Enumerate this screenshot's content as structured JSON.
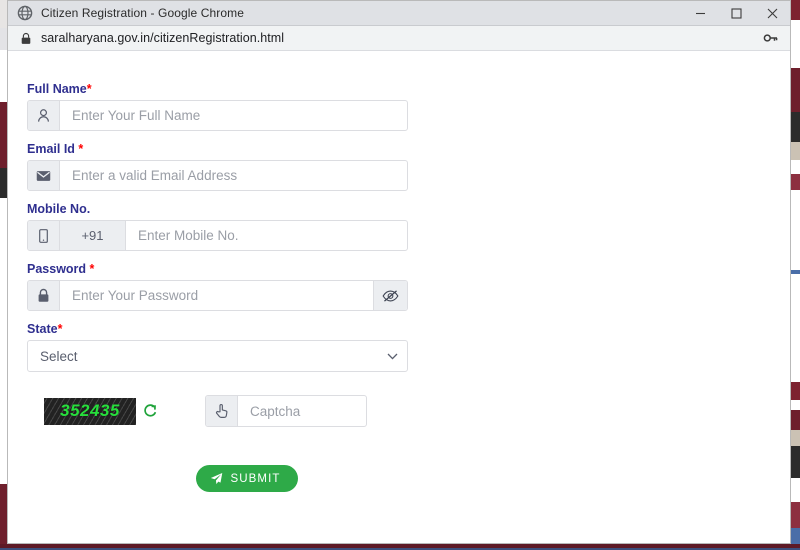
{
  "window": {
    "title": "Citizen Registration - Google Chrome",
    "app_icon": "chrome-globe-icon",
    "controls": {
      "minimize": "minimize-icon",
      "maximize": "maximize-icon",
      "close": "close-icon"
    }
  },
  "addressbar": {
    "security_icon": "lock-icon",
    "url": "saralharyana.gov.in/citizenRegistration.html",
    "password_manager_icon": "key-icon"
  },
  "form": {
    "fields": [
      {
        "label": "Full Name",
        "required": true,
        "required_mark": "*",
        "icon": "user-icon",
        "placeholder": "Enter Your Full Name",
        "value": ""
      },
      {
        "label": "Email Id",
        "required": true,
        "required_mark": "*",
        "icon": "envelope-icon",
        "placeholder": "Enter a valid Email Address",
        "value": ""
      },
      {
        "label": "Mobile No.",
        "required": false,
        "required_mark": "",
        "icon": "mobile-phone-icon",
        "country_code": "+91",
        "placeholder": "Enter Mobile No.",
        "value": ""
      },
      {
        "label": "Password",
        "required": true,
        "required_mark": "*",
        "icon": "padlock-icon",
        "placeholder": "Enter Your Password",
        "value": "",
        "toggle_icon": "eye-slash-icon"
      }
    ],
    "state": {
      "label": "State",
      "required_mark": "*",
      "selected": "Select",
      "options": [
        "Select"
      ],
      "caret_icon": "chevron-down-icon"
    },
    "captcha": {
      "code": "352435",
      "refresh_icon": "refresh-icon",
      "input_icon": "hand-pointer-icon",
      "placeholder": "Captcha",
      "value": ""
    },
    "submit": {
      "label": "SUBMIT",
      "icon": "paper-plane-icon"
    }
  },
  "colors": {
    "label_blue": "#2f2f8f",
    "required_red": "#ff0000",
    "captcha_green": "#27e03c",
    "submit_green": "#2eaa48",
    "titlebar": "#dfe1e5",
    "toolbar": "#f1f3f4"
  }
}
